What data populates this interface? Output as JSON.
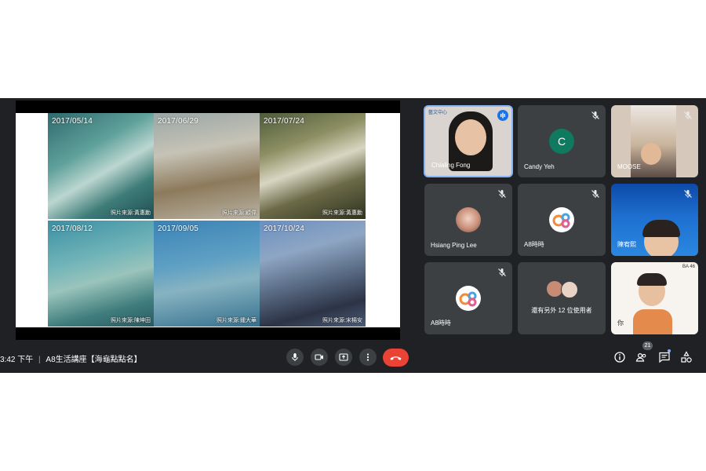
{
  "slide": {
    "photos": [
      {
        "date": "2017/05/14",
        "credit": "照片來源:黃惠勳"
      },
      {
        "date": "2017/06/29",
        "credit": "照片來源:顧偉"
      },
      {
        "date": "2017/07/24",
        "credit": "照片來源:黃惠勳"
      },
      {
        "date": "2017/08/12",
        "credit": "照片來源:陳坤田"
      },
      {
        "date": "2017/09/05",
        "credit": "照片來源:鍾大華"
      },
      {
        "date": "2017/10/24",
        "credit": "照片來源:宋楊安"
      }
    ]
  },
  "participants": [
    {
      "name": "Chialing Fong",
      "badge": "藝文中心"
    },
    {
      "name": "Candy Yeh",
      "initial": "C",
      "color": "#0f7a5f"
    },
    {
      "name": "MOOSE"
    },
    {
      "name": "Hsiang Ping Lee"
    },
    {
      "name": "A8時時"
    },
    {
      "name": "陳宥熙"
    },
    {
      "name": "A8時時"
    },
    {
      "name": "還有另外 12 位使用者"
    },
    {
      "name": "你",
      "badge": "BA 46"
    }
  ],
  "bottom_bar": {
    "time": "3:42 下午",
    "separator": "|",
    "meeting_title": "A8生活講座【海龜點點名】",
    "people_count": "21"
  },
  "icons": [
    "mic-icon",
    "camera-icon",
    "present-icon",
    "more-options-icon",
    "hangup-icon",
    "info-icon",
    "people-icon",
    "chat-icon",
    "activities-icon",
    "mic-off-icon",
    "speaking-icon"
  ],
  "colors": {
    "background": "#202124",
    "tile": "#3c4043",
    "hangup": "#ea4335",
    "active_border": "#8ab4f8"
  }
}
